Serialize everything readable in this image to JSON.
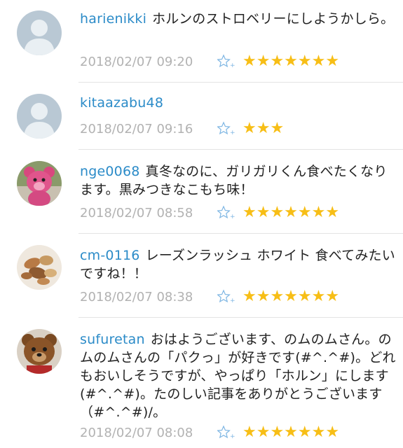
{
  "comments": [
    {
      "username": "harienikki",
      "text": "ホルンのストロベリーにしようかしら。",
      "timestamp": "2018/02/07 09:20",
      "stars": "★★★★★★★",
      "avatar": "default-person"
    },
    {
      "username": "kitaazabu48",
      "text": "",
      "timestamp": "2018/02/07 09:16",
      "stars": "★★★",
      "avatar": "default-person"
    },
    {
      "username": "nge0068",
      "text": "真冬なのに、ガリガリくん食べたくなります。黒みつきなこもち味！",
      "timestamp": "2018/02/07 08:58",
      "stars": "★★★★★★★",
      "avatar": "pink-bear-plush"
    },
    {
      "username": "cm-0116",
      "text": "レーズンラッシュ ホワイト 食べてみたいですね！！",
      "timestamp": "2018/02/07 08:38",
      "stars": "★★★★★★★",
      "avatar": "mixed-nuts"
    },
    {
      "username": "sufuretan",
      "text": "おはようございます、のムのムさん。のムのムさんの「パクっ」が好きです(#^.^#)。どれもおいしそうですが、やっぱり「ホルン」にします(#^.^#)。たのしい記事をありがとうございます（#^.^#)/。",
      "timestamp": "2018/02/07 08:08",
      "stars": "★★★★★★★",
      "avatar": "teddy-bear"
    }
  ],
  "colors": {
    "username": "#2b8bc8",
    "star": "#f7be16",
    "timestamp": "#b2b2b2",
    "add_star_icon": "#7eb6e3"
  }
}
